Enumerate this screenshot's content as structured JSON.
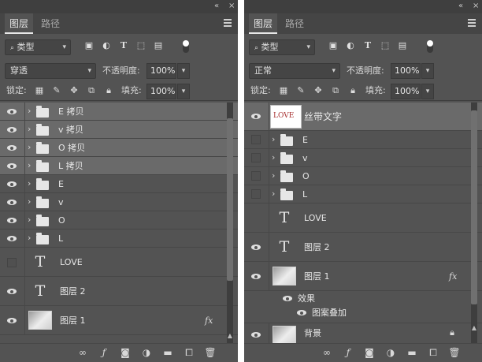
{
  "colors": {
    "panel_bg": "#535353",
    "tab_bar_bg": "#454545",
    "selected_row_bg": "#6a6a6a",
    "divider": "#474747",
    "text": "#e6e6e6",
    "ribbon_text_color": "#a83232"
  },
  "left_panel": {
    "tabs": [
      {
        "label": "图层",
        "active": true
      },
      {
        "label": "路径",
        "active": false
      }
    ],
    "filter_kind": "类型",
    "blend_mode": "穿透",
    "opacity_label": "不透明度:",
    "opacity_value": "100%",
    "lock_label": "锁定:",
    "fill_label": "填充:",
    "fill_value": "100%",
    "layers": [
      {
        "type": "group",
        "name": "E 拷贝",
        "visible": true,
        "selected": true
      },
      {
        "type": "group",
        "name": "v 拷贝",
        "visible": true,
        "selected": true
      },
      {
        "type": "group",
        "name": "O 拷贝",
        "visible": true,
        "selected": true
      },
      {
        "type": "group",
        "name": "L 拷贝",
        "visible": true,
        "selected": true
      },
      {
        "type": "group",
        "name": "E",
        "visible": true,
        "selected": false
      },
      {
        "type": "group",
        "name": "v",
        "visible": true,
        "selected": false
      },
      {
        "type": "group",
        "name": "O",
        "visible": true,
        "selected": false
      },
      {
        "type": "group",
        "name": "L",
        "visible": true,
        "selected": false
      },
      {
        "type": "text",
        "name": "LOVE",
        "visible": false,
        "selected": false
      },
      {
        "type": "text",
        "name": "图层 2",
        "visible": true,
        "selected": false
      },
      {
        "type": "pixel",
        "name": "图层 1",
        "visible": true,
        "selected": false,
        "fx": "fx"
      }
    ],
    "footer_icons": [
      "link-icon",
      "fx-icon",
      "mask-icon",
      "adjustment-icon",
      "folder-icon",
      "new-layer-icon",
      "trash-icon"
    ],
    "fx_label": "fx"
  },
  "right_panel": {
    "tabs": [
      {
        "label": "图层",
        "active": true
      },
      {
        "label": "路径",
        "active": false
      }
    ],
    "filter_kind": "类型",
    "blend_mode": "正常",
    "opacity_label": "不透明度:",
    "opacity_value": "100%",
    "lock_label": "锁定:",
    "fill_label": "填充:",
    "fill_value": "100%",
    "layers": [
      {
        "type": "smart",
        "name": "丝带文字",
        "visible": true,
        "selected": true,
        "thumb_text": "LOVE"
      },
      {
        "type": "group",
        "name": "E",
        "visible": false,
        "selected": false
      },
      {
        "type": "group",
        "name": "v",
        "visible": false,
        "selected": false
      },
      {
        "type": "group",
        "name": "O",
        "visible": false,
        "selected": false
      },
      {
        "type": "group",
        "name": "L",
        "visible": false,
        "selected": false
      },
      {
        "type": "text",
        "name": "LOVE",
        "visible": false,
        "selected": false
      },
      {
        "type": "text",
        "name": "图层 2",
        "visible": true,
        "selected": false
      },
      {
        "type": "pixel",
        "name": "图层 1",
        "visible": true,
        "selected": false,
        "fx": "fx"
      }
    ],
    "effects_label": "效果",
    "effect_item": "图案叠加",
    "background_label": "背景",
    "fx_label": "fx"
  }
}
